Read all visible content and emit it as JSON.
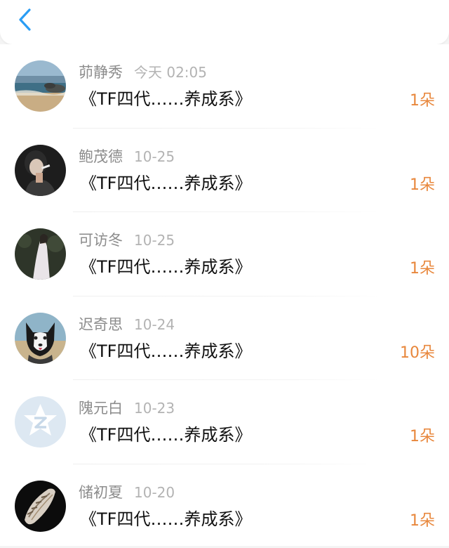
{
  "header": {
    "back_icon": "chevron-left-icon",
    "accent_color": "#2a9df4"
  },
  "list": {
    "items": [
      {
        "name": "茆静秀",
        "time": "今天 02:05",
        "title": "《TF四代……养成系》",
        "count": "1朵",
        "avatar": "beach-photo"
      },
      {
        "name": "鲍茂德",
        "time": "10-25",
        "title": "《TF四代……养成系》",
        "count": "1朵",
        "avatar": "girl-portrait"
      },
      {
        "name": "可访冬",
        "time": "10-25",
        "title": "《TF四代……养成系》",
        "count": "1朵",
        "avatar": "girl-in-white-dress"
      },
      {
        "name": "迟奇思",
        "time": "10-24",
        "title": "《TF四代……养成系》",
        "count": "10朵",
        "avatar": "husky-dog"
      },
      {
        "name": "隗元白",
        "time": "10-23",
        "title": "《TF四代……养成系》",
        "count": "1朵",
        "avatar": "default-qzone-star-icon"
      },
      {
        "name": "储初夏",
        "time": "10-20",
        "title": "《TF四代……养成系》",
        "count": "1朵",
        "avatar": "seashell-photo"
      }
    ]
  },
  "colors": {
    "count": "#e8873c",
    "name": "#8c8c8c",
    "time": "#b3b3b3"
  }
}
